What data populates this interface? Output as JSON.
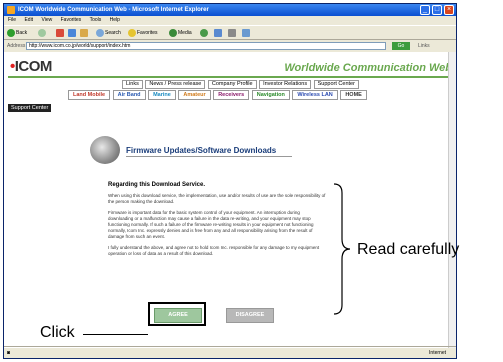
{
  "window": {
    "title": "ICOM Worldwide Communication Web - Microsoft Internet Explorer",
    "menu": [
      "File",
      "Edit",
      "View",
      "Favorites",
      "Tools",
      "Help"
    ]
  },
  "toolbar": {
    "back": "Back",
    "search": "Search",
    "favorites": "Favorites",
    "media": "Media"
  },
  "address": {
    "label": "Address",
    "url": "http://www.icom.co.jp/world/support/index.htm",
    "go": "Go",
    "links": "Links"
  },
  "site": {
    "logo": "ICOM",
    "tagline": "Worldwide Communication Web",
    "top_links": [
      "Links",
      "News / Press release",
      "Company Profile",
      "Investor Relations",
      "Support Center"
    ],
    "categories": [
      "Land Mobile",
      "Air Band",
      "Marine",
      "Amateur",
      "Receivers",
      "Navigation",
      "Wireless LAN",
      "HOME"
    ],
    "support_tab": "Support Center"
  },
  "banner": {
    "title": "Firmware Updates/Software Downloads"
  },
  "content": {
    "heading": "Regarding this Download Service.",
    "p1": "When using this download service, the implementation, use and/or results of use are the sole responsibility of the person making the download.",
    "p2": "Firmware is important data for the basic system control of your equipment. An interruption during downloading or a malfunction may cause a failure in the data re-writing, and your equipment may stop functioning normally. If such a failure of the firmware re-writing results in your equipment not functioning normally, Icom Inc. expressly denies and is free from any and all responsibility arising from the result of damage from such an event.",
    "p3": "I fully understand the above, and agree not to hold Icom Inc. responsible for any damage to my equipment operation or loss of data as a result of this download."
  },
  "buttons": {
    "agree": "AGREE",
    "disagree": "DISAGREE"
  },
  "status": {
    "zone": "Internet"
  },
  "annotations": {
    "read": "Read carefully",
    "click": "Click"
  },
  "colors": {
    "title_bar": "#0a4fd0",
    "tagline": "#6aa84f",
    "agree": "#9ec79e",
    "disagree": "#b8b8b8"
  }
}
